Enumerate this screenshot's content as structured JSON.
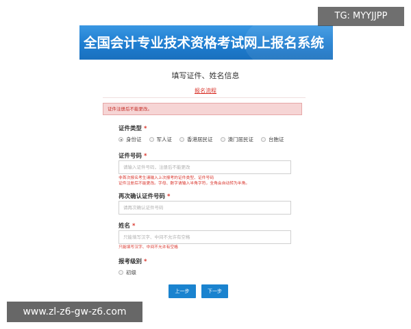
{
  "watermarks": {
    "telegram": "TG: MYYJJPP",
    "website": "www.zl-z6-gw-z6.com"
  },
  "header": {
    "title": "全国会计专业技术资格考试网上报名系统",
    "accent_color": "#1e7dd0"
  },
  "page": {
    "step_title": "填写证件、姓名信息",
    "flow_link": "报名流程"
  },
  "alert": {
    "text": "证件注册后不能更改。",
    "color": "#c5302a"
  },
  "form": {
    "id_type": {
      "label": "证件类型",
      "required_mark": "*",
      "options": [
        {
          "label": "身份证",
          "checked": true
        },
        {
          "label": "军人证",
          "checked": false
        },
        {
          "label": "香港居民证",
          "checked": false
        },
        {
          "label": "澳门居民证",
          "checked": false
        },
        {
          "label": "台胞证",
          "checked": false
        }
      ]
    },
    "id_number": {
      "label": "证件号码",
      "required_mark": "*",
      "value": "",
      "placeholder": "请输入证件号码，注册后不能更改",
      "hint_line1": "非首次报名考生请输入上次报考的证件类型、证件号码",
      "hint_line2": "证件注册后不能更改。字母、数字请输入半角字符，全角会自动转为半角。"
    },
    "id_confirm": {
      "label": "再次确认证件号码",
      "required_mark": "*",
      "value": "",
      "placeholder": "请再次确认证件号码"
    },
    "name": {
      "label": "姓名",
      "required_mark": "*",
      "value": "",
      "placeholder": "只能填写汉字、中间不允许有空格",
      "hint": "只能填写汉字、中间不允许有空格"
    },
    "level": {
      "label": "报考级别",
      "required_mark": "*",
      "options": [
        {
          "label": "初级",
          "checked": false
        }
      ]
    }
  },
  "buttons": {
    "prev": "上一步",
    "next": "下一步",
    "color": "#1a83cf"
  }
}
